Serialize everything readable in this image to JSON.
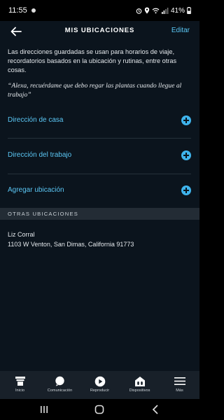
{
  "status_bar": {
    "time": "11:55",
    "battery": "41%"
  },
  "header": {
    "title": "MIS UBICACIONES",
    "edit_label": "Editar"
  },
  "intro_text": "Las direcciones guardadas se usan para horarios de viaje, recordatorios basados en la ubicación y rutinas, entre otras cosas.",
  "quote_text": "“Alexa, recuérdame que debo regar las plantas cuando llegue al trabajo”",
  "address_rows": [
    {
      "label": "Dirección de casa",
      "icon": "add-circle-icon"
    },
    {
      "label": "Dirección del trabajo",
      "icon": "add-circle-icon"
    },
    {
      "label": "Agregar ubicación",
      "icon": "add-circle-icon"
    }
  ],
  "other_locations": {
    "header": "OTRAS UBICACIONES",
    "items": [
      {
        "name": "Liz Corral",
        "address": "1103 W Venton, San Dimas, California 91773"
      }
    ]
  },
  "bottom_nav": [
    {
      "label": "Inicio",
      "icon": "home-icon"
    },
    {
      "label": "Comunicación",
      "icon": "chat-bubble-icon"
    },
    {
      "label": "Reproducir",
      "icon": "play-icon"
    },
    {
      "label": "Dispositivos",
      "icon": "devices-icon"
    },
    {
      "label": "Más",
      "icon": "menu-icon"
    }
  ],
  "colors": {
    "accent": "#5bc7f5",
    "background": "#0b141d",
    "section": "#232c35",
    "nav": "#182029"
  }
}
